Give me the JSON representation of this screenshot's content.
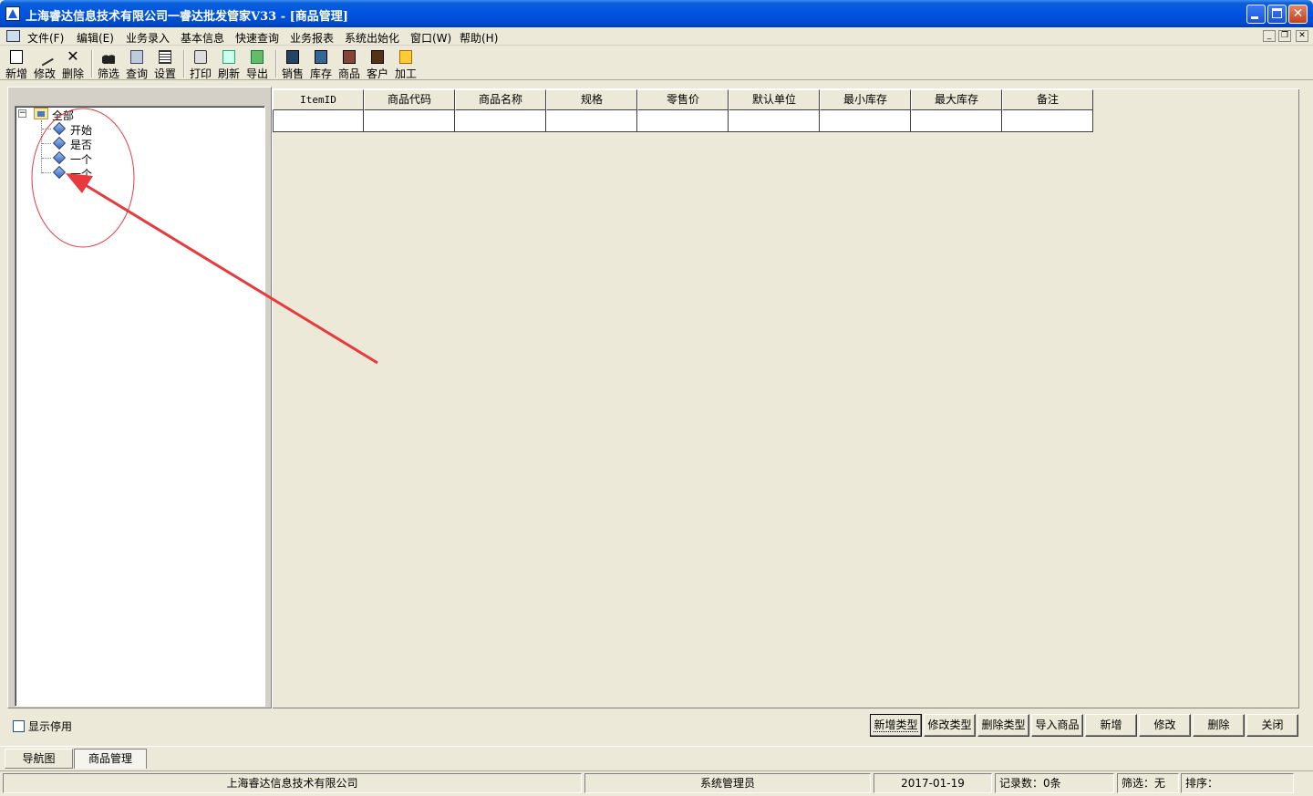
{
  "window": {
    "title": "上海睿达信息技术有限公司一睿达批发管家V33 - [商品管理]"
  },
  "menu": {
    "items": [
      "文件(F)",
      "编辑(E)",
      "业务录入",
      "基本信息",
      "快速查询",
      "业务报表",
      "系统出始化",
      "窗口(W)",
      "帮助(H)"
    ]
  },
  "toolbar": {
    "groups": [
      [
        {
          "label": "新增",
          "icon": "new-doc-icon"
        },
        {
          "label": "修改",
          "icon": "edit-icon"
        },
        {
          "label": "删除",
          "icon": "delete-icon"
        }
      ],
      [
        {
          "label": "筛选",
          "icon": "binoculars-icon"
        },
        {
          "label": "查询",
          "icon": "search-icon"
        },
        {
          "label": "设置",
          "icon": "grid-icon"
        }
      ],
      [
        {
          "label": "打印",
          "icon": "printer-icon"
        },
        {
          "label": "刷新",
          "icon": "refresh-icon"
        },
        {
          "label": "导出",
          "icon": "excel-icon"
        }
      ],
      [
        {
          "label": "销售",
          "icon": "sales-icon"
        },
        {
          "label": "库存",
          "icon": "inventory-icon"
        },
        {
          "label": "商品",
          "icon": "goods-icon"
        },
        {
          "label": "客户",
          "icon": "customer-icon"
        },
        {
          "label": "加工",
          "icon": "process-icon"
        }
      ]
    ]
  },
  "tree": {
    "expander": "−",
    "root": "全部",
    "children": [
      "开始",
      "是否",
      "一个",
      "一个"
    ]
  },
  "grid": {
    "columns": [
      "ItemID",
      "商品代码",
      "商品名称",
      "规格",
      "零售价",
      "默认单位",
      "最小库存",
      "最大库存",
      "备注"
    ]
  },
  "bottom": {
    "show_disabled": "显示停用",
    "buttons": [
      "新增类型",
      "修改类型",
      "删除类型",
      "导入商品",
      "新增",
      "修改",
      "删除",
      "关闭"
    ]
  },
  "tabs": [
    "导航图",
    "商品管理"
  ],
  "status": {
    "company": "上海睿达信息技术有限公司",
    "user": "系统管理员",
    "date": "2017-01-19",
    "records": "记录数：0条",
    "filter": "筛选：无",
    "sort": "排序："
  },
  "colors": {
    "title_bar": "#0054e3",
    "face": "#ece9d8",
    "annotation": "#e8393c"
  }
}
